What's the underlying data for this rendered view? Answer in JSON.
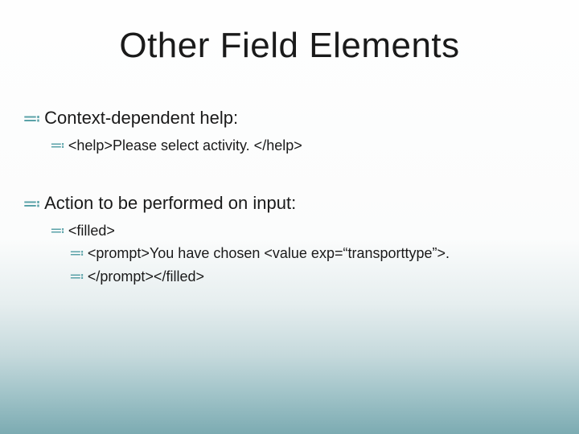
{
  "bullet_glyph": "≕",
  "title": "Other Field Elements",
  "lines": {
    "l1": "Context-dependent help:",
    "l2": "<help>Please select activity. </help>",
    "l3": "Action to be performed on input:",
    "l4": "<filled>",
    "l5": "<prompt>You have chosen <value exp=“transporttype”>.",
    "l6": "</prompt></filled>"
  }
}
